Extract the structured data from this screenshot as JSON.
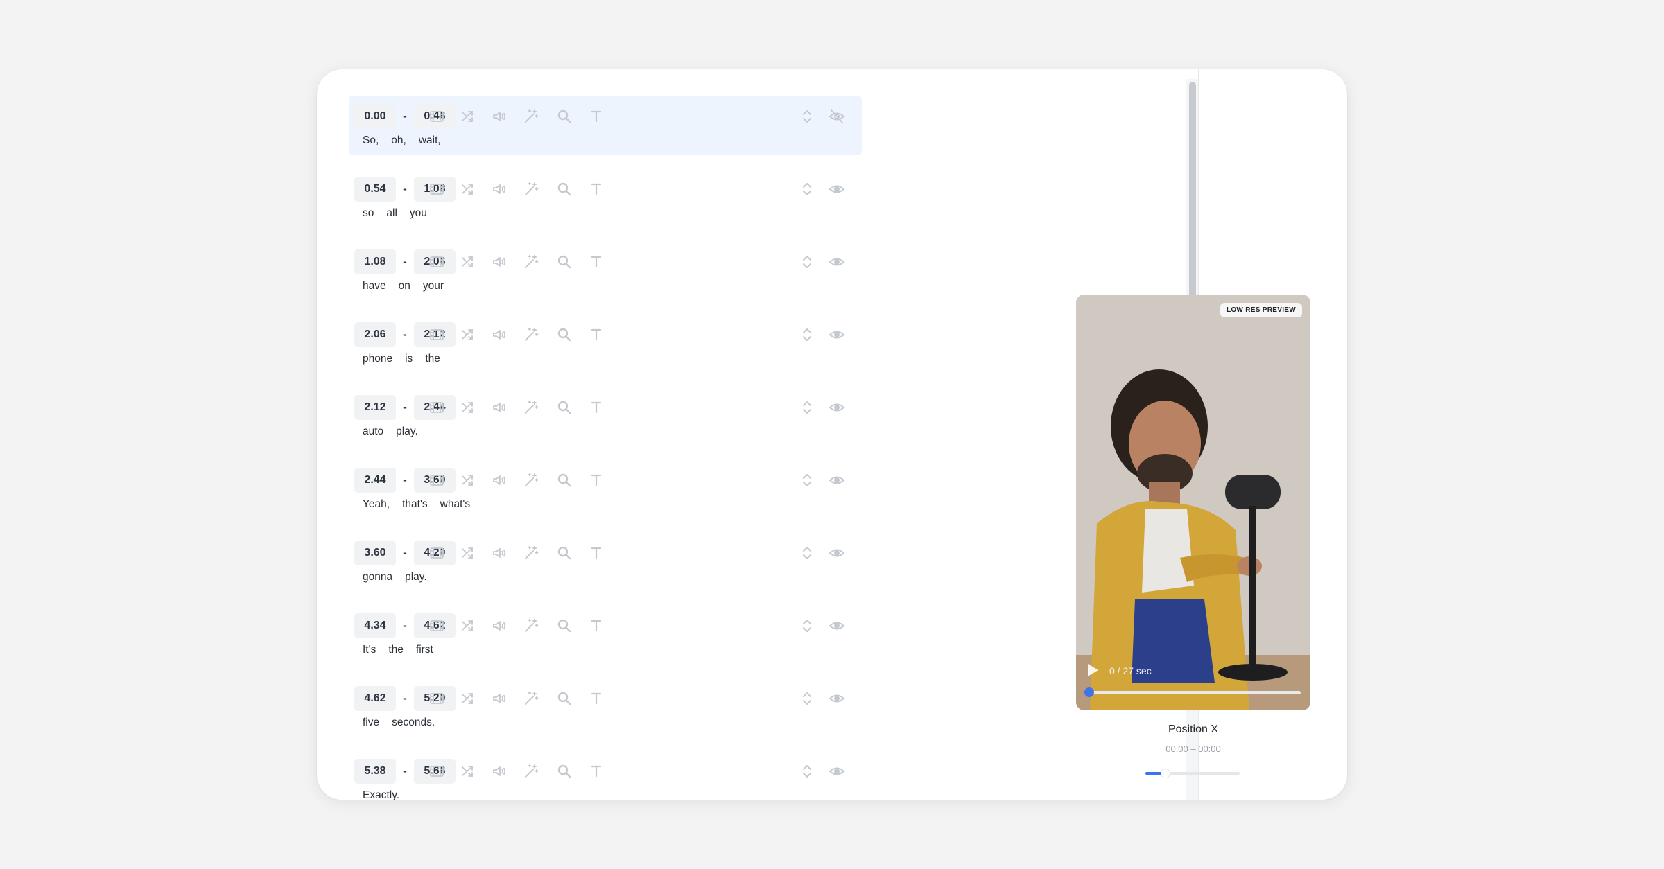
{
  "segments": [
    {
      "start": "0.00",
      "end": "0.46",
      "words": [
        "So,",
        "oh,",
        "wait,"
      ],
      "active": true,
      "visibility": "hidden"
    },
    {
      "start": "0.54",
      "end": "1.08",
      "words": [
        "so",
        "all",
        "you"
      ],
      "active": false,
      "visibility": "visible"
    },
    {
      "start": "1.08",
      "end": "2.06",
      "words": [
        "have",
        "on",
        "your"
      ],
      "active": false,
      "visibility": "visible"
    },
    {
      "start": "2.06",
      "end": "2.12",
      "words": [
        "phone",
        "is",
        "the"
      ],
      "active": false,
      "visibility": "visible"
    },
    {
      "start": "2.12",
      "end": "2.44",
      "words": [
        "auto",
        "play."
      ],
      "active": false,
      "visibility": "visible"
    },
    {
      "start": "2.44",
      "end": "3.60",
      "words": [
        "Yeah,",
        "that's",
        "what's"
      ],
      "active": false,
      "visibility": "visible"
    },
    {
      "start": "3.60",
      "end": "4.20",
      "words": [
        "gonna",
        "play."
      ],
      "active": false,
      "visibility": "visible"
    },
    {
      "start": "4.34",
      "end": "4.62",
      "words": [
        "It's",
        "the",
        "first"
      ],
      "active": false,
      "visibility": "visible"
    },
    {
      "start": "4.62",
      "end": "5.20",
      "words": [
        "five",
        "seconds."
      ],
      "active": false,
      "visibility": "visible"
    },
    {
      "start": "5.38",
      "end": "5.66",
      "words": [
        "Exactly."
      ],
      "active": false,
      "visibility": "visible"
    }
  ],
  "separator": "-",
  "toolbar_icons": [
    "film-icon",
    "shuffle-icon",
    "volume-icon",
    "magic-wand-icon",
    "search-icon",
    "text-icon"
  ],
  "row_icons": [
    "reorder-icon",
    "visibility-icon"
  ],
  "preview": {
    "badge": "LOW RES PREVIEW",
    "time_readout": "0 / 27 sec",
    "position_label": "Position X",
    "position_range": "00:00 – 00:00",
    "position_slider_value": 0.2
  },
  "colors": {
    "accent": "#3d74ea",
    "active_row": "#eef4fd",
    "icon_muted": "#c4c9d0",
    "time_box": "#f1f2f4"
  }
}
